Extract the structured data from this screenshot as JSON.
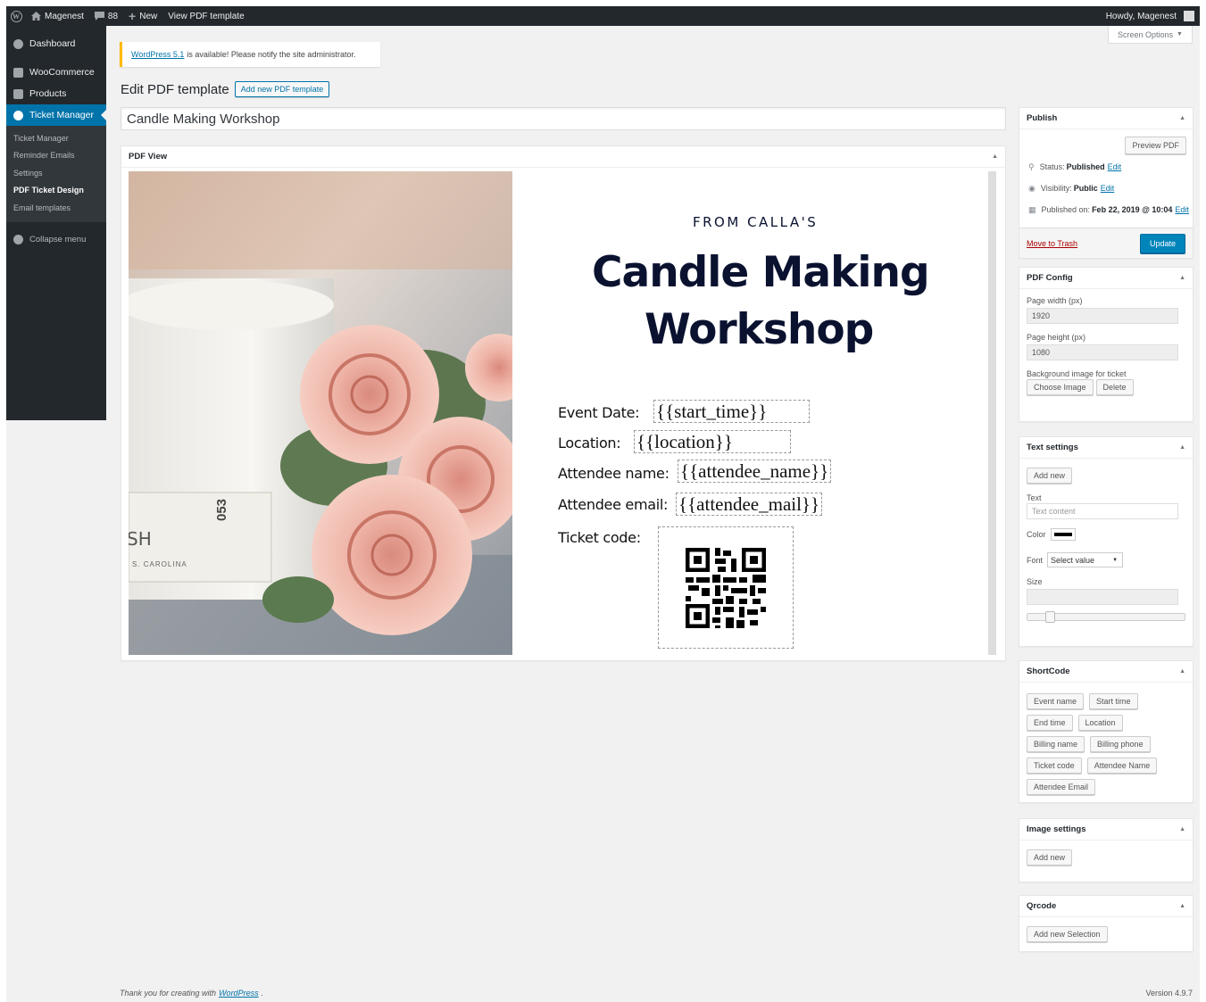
{
  "adminbar": {
    "site": "Magenest",
    "comments": "88",
    "new": "New",
    "view": "View PDF template",
    "howdy": "Howdy, Magenest"
  },
  "sidebar": {
    "dashboard": "Dashboard",
    "woocommerce": "WooCommerce",
    "products": "Products",
    "ticket_manager": "Ticket Manager",
    "sub": [
      "Ticket Manager",
      "Reminder Emails",
      "Settings",
      "PDF Ticket Design",
      "Email templates"
    ],
    "collapse": "Collapse menu"
  },
  "notice": {
    "link": "WordPress 5.1",
    "text": "is available! Please notify the site administrator."
  },
  "screen_options": "Screen Options",
  "page": {
    "title": "Edit PDF template",
    "add_new": "Add new PDF template",
    "post_title": "Candle Making Workshop"
  },
  "pdf": {
    "box_title": "PDF View",
    "from": "FROM CALLA'S",
    "heading1": "Candle Making",
    "heading2": "Workshop",
    "labels": {
      "date": "Event Date:",
      "location": "Location:",
      "name": "Attendee name:",
      "email": "Attendee email:",
      "code": "Ticket code:"
    },
    "placeholders": {
      "date": "{{start_time}}",
      "location": "{{location}}",
      "name": "{{attendee_name}}",
      "email": "{{attendee_mail}}"
    },
    "jar_text1": "SH",
    "jar_text2": "S. CAROLINA",
    "jar_text3": "053"
  },
  "publish": {
    "title": "Publish",
    "preview": "Preview PDF",
    "status_label": "Status:",
    "status": "Published",
    "visibility_label": "Visibility:",
    "visibility": "Public",
    "published_label": "Published on:",
    "published": "Feb 22, 2019 @ 10:04",
    "edit": "Edit",
    "trash": "Move to Trash",
    "update": "Update"
  },
  "pdf_config": {
    "title": "PDF Config",
    "width_label": "Page width (px)",
    "width": "1920",
    "height_label": "Page height (px)",
    "height": "1080",
    "bg_label": "Background image for ticket",
    "choose": "Choose Image",
    "delete": "Delete"
  },
  "text_settings": {
    "title": "Text settings",
    "add_new": "Add new",
    "text_label": "Text",
    "text_placeholder": "Text content",
    "color_label": "Color",
    "font_label": "Font",
    "font_value": "Select value",
    "size_label": "Size"
  },
  "shortcode": {
    "title": "ShortCode",
    "buttons": [
      "Event name",
      "Start time",
      "End time",
      "Location",
      "Billing name",
      "Billing phone",
      "Ticket code",
      "Attendee Name",
      "Attendee Email"
    ]
  },
  "image_settings": {
    "title": "Image settings",
    "add_new": "Add new"
  },
  "qrcode": {
    "title": "Qrcode",
    "add_new": "Add new Selection"
  },
  "footer": {
    "text": "Thank you for creating with",
    "link": "WordPress",
    "version": "Version 4.9.7"
  }
}
